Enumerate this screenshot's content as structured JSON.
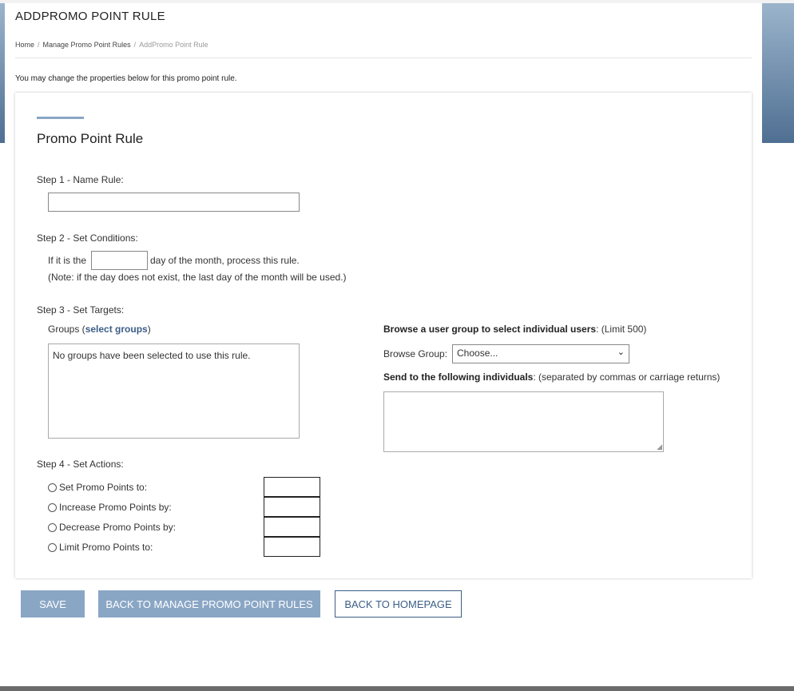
{
  "page": {
    "title": "ADDPROMO POINT RULE",
    "intro": "You may change the properties below for this promo point rule."
  },
  "breadcrumb": {
    "home": "Home",
    "manage": "Manage Promo Point Rules",
    "current": "AddPromo Point Rule",
    "separator": "/"
  },
  "card": {
    "title": "Promo Point Rule"
  },
  "step1": {
    "label": "Step 1 - Name Rule:",
    "value": ""
  },
  "step2": {
    "label": "Step 2 - Set Conditions:",
    "prefix": "If it is the",
    "suffix": "day of the month, process this rule.",
    "note": "(Note: if the day does not exist, the last day of the month will be used.)",
    "value": ""
  },
  "step3": {
    "label": "Step 3 - Set Targets:",
    "groups_label": "Groups (",
    "groups_link": "select groups",
    "groups_close": ")",
    "groups_empty": "No groups have been selected to use this rule.",
    "browse_bold": "Browse a user group to select individual users",
    "browse_rest": ": (Limit 500)",
    "browse_group_label": "Browse Group:",
    "browse_group_value": "Choose...",
    "send_bold": "Send to the following individuals",
    "send_rest": ": (separated by commas or carriage returns)"
  },
  "step4": {
    "label": "Step 4 - Set Actions:",
    "actions": [
      {
        "label": "Set Promo Points to:"
      },
      {
        "label": "Increase Promo Points by:"
      },
      {
        "label": "Decrease Promo Points by:"
      },
      {
        "label": "Limit Promo Points to:"
      }
    ]
  },
  "buttons": {
    "save": "SAVE",
    "back_manage": "BACK TO MANAGE PROMO POINT RULES",
    "back_home": "BACK TO HOMEPAGE"
  },
  "colors": {
    "accent": "#8aa6c5",
    "link": "#3b5e86"
  },
  "icons": {
    "select_chevron": "chevron-down-icon",
    "textarea_resize": "resize-grip-icon"
  }
}
